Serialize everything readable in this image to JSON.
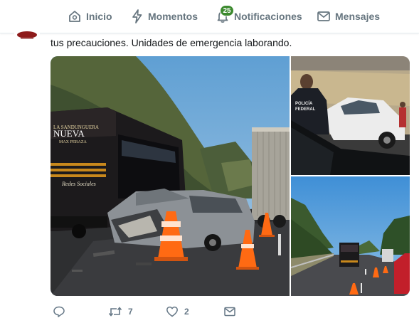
{
  "nav": {
    "home_label": "Inicio",
    "moments_label": "Momentos",
    "notifications_label": "Notificaciones",
    "notifications_count": "25",
    "messages_label": "Mensajes"
  },
  "tweet": {
    "text": "tus precauciones. Unidades de emergencia laborando.",
    "photos": [
      {
        "subject": "bus-and-car-crash",
        "bus_sign_line1": "LA SANDUNGUERA",
        "bus_sign_line2": "NUEVA",
        "bus_sign_line3": "MAX PERAZA",
        "bus_side_text": "Redes Sociales"
      },
      {
        "subject": "police-officer-and-damaged-white-car",
        "vest_text_line1": "POLICÍA",
        "vest_text_line2": "FEDERAL"
      },
      {
        "subject": "highway-traffic-with-cones"
      }
    ],
    "actions": {
      "reply_icon": "reply-icon",
      "retweet_icon": "retweet-icon",
      "retweet_count": "7",
      "like_icon": "heart-icon",
      "like_count": "2",
      "message_icon": "envelope-icon"
    }
  },
  "colors": {
    "nav_text": "#66757f",
    "badge": "#3d8a2f",
    "action_text": "#657786",
    "cone_orange": "#ff6a13"
  }
}
